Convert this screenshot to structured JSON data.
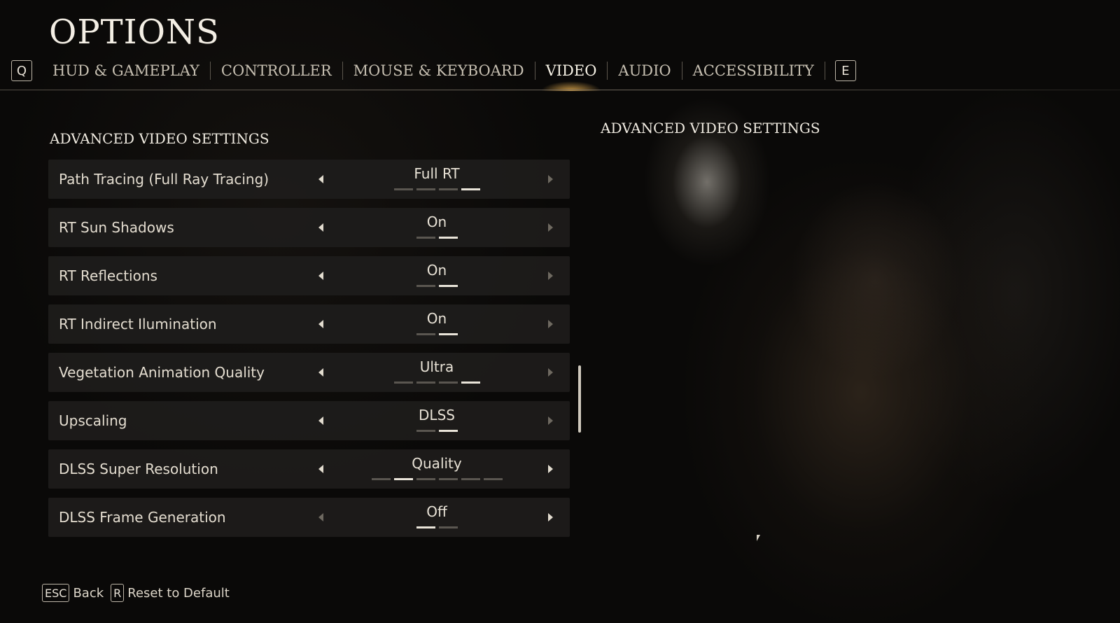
{
  "header": {
    "title": "OPTIONS"
  },
  "tabs": {
    "left_key": "Q",
    "right_key": "E",
    "items": [
      {
        "label": "HUD & GAMEPLAY"
      },
      {
        "label": "CONTROLLER"
      },
      {
        "label": "MOUSE & KEYBOARD"
      },
      {
        "label": "VIDEO",
        "active": true
      },
      {
        "label": "AUDIO"
      },
      {
        "label": "ACCESSIBILITY"
      }
    ]
  },
  "section": {
    "title": "ADVANCED VIDEO SETTINGS"
  },
  "description": {
    "title": "ADVANCED VIDEO SETTINGS"
  },
  "settings": [
    {
      "label": "Path Tracing (Full Ray Tracing)",
      "value": "Full RT",
      "option_count": 4,
      "selected_index": 3
    },
    {
      "label": "RT Sun Shadows",
      "value": "On",
      "option_count": 2,
      "selected_index": 1
    },
    {
      "label": "RT Reflections",
      "value": "On",
      "option_count": 2,
      "selected_index": 1
    },
    {
      "label": "RT Indirect Ilumination",
      "value": "On",
      "option_count": 2,
      "selected_index": 1
    },
    {
      "label": "Vegetation Animation Quality",
      "value": "Ultra",
      "option_count": 4,
      "selected_index": 3
    },
    {
      "label": "Upscaling",
      "value": "DLSS",
      "option_count": 2,
      "selected_index": 1
    },
    {
      "label": "DLSS Super Resolution",
      "value": "Quality",
      "option_count": 6,
      "selected_index": 1
    },
    {
      "label": "DLSS Frame Generation",
      "value": "Off",
      "option_count": 2,
      "selected_index": 0
    }
  ],
  "footer": {
    "back_key": "ESC",
    "back_label": "Back",
    "reset_key": "R",
    "reset_label": "Reset to Default"
  },
  "colors": {
    "accent_glow": "#e8b050",
    "text": "#e4ddd0",
    "pip_active": "#e9e4d9",
    "pip_inactive": "#5a5650"
  }
}
